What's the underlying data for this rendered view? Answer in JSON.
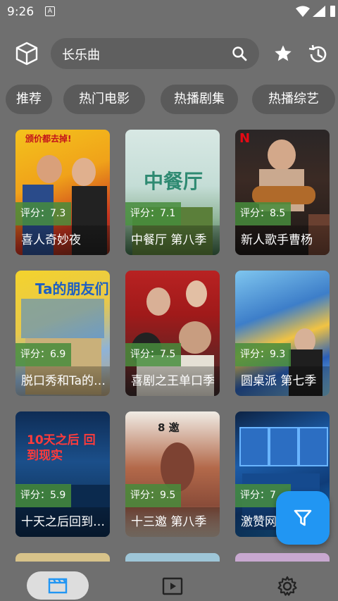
{
  "status_bar": {
    "time": "9:26",
    "indicator": "A"
  },
  "search": {
    "query": "长乐曲"
  },
  "icons": {
    "logo": "cube-icon",
    "search": "search-icon",
    "favorites": "star-icon",
    "history": "history-icon",
    "filter": "filter-icon",
    "nav_movies": "clapperboard-icon",
    "nav_player": "play-square-icon",
    "nav_settings": "gear-icon"
  },
  "categories": [
    {
      "label": "推荐"
    },
    {
      "label": "热门电影"
    },
    {
      "label": "热播剧集"
    },
    {
      "label": "热播综艺"
    }
  ],
  "items": [
    {
      "rating": "评分：7.3",
      "title": "喜人奇妙夜",
      "art_text": "颁价都去掉!"
    },
    {
      "rating": "评分：7.1",
      "title": "中餐厅 第八季",
      "art_text": "中餐厅"
    },
    {
      "rating": "评分：8.5",
      "title": "新人歌手曹杨",
      "art_text": "N"
    },
    {
      "rating": "评分：6.9",
      "title": "脱口秀和Ta的朋友们",
      "art_text": "Ta的朋友们"
    },
    {
      "rating": "评分：7.5",
      "title": "喜剧之王单口季",
      "art_text": ""
    },
    {
      "rating": "评分：9.3",
      "title": "圆桌派 第七季",
      "art_text": ""
    },
    {
      "rating": "评分：5.9",
      "title": "十天之后回到现实",
      "art_text": "10天之后 回到现实"
    },
    {
      "rating": "评分：9.5",
      "title": "十三邀 第八季",
      "art_text": "8 邀"
    },
    {
      "rating": "评分：7",
      "title": "激赞网红",
      "art_text": ""
    }
  ],
  "colors": {
    "background": "#6f6f6f",
    "fab": "#2196f3",
    "rating_bg": "#468c3c"
  }
}
